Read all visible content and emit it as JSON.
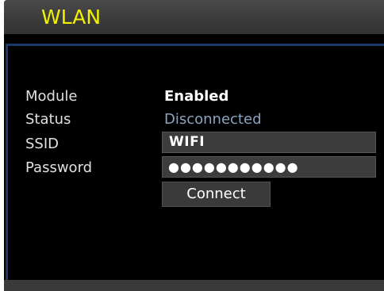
{
  "header": {
    "title": "WLAN"
  },
  "form": {
    "module": {
      "label": "Module",
      "value": "Enabled"
    },
    "status": {
      "label": "Status",
      "value": "Disconnected"
    },
    "ssid": {
      "label": "SSID",
      "value": "WIFI"
    },
    "password": {
      "label": "Password",
      "value": "●●●●●●●●●●●"
    },
    "connect_label": "Connect"
  },
  "colors": {
    "title": "#f2f200",
    "status_text": "#8aa3bf",
    "accent_border": "#1a3a6e",
    "background": "#000000"
  }
}
